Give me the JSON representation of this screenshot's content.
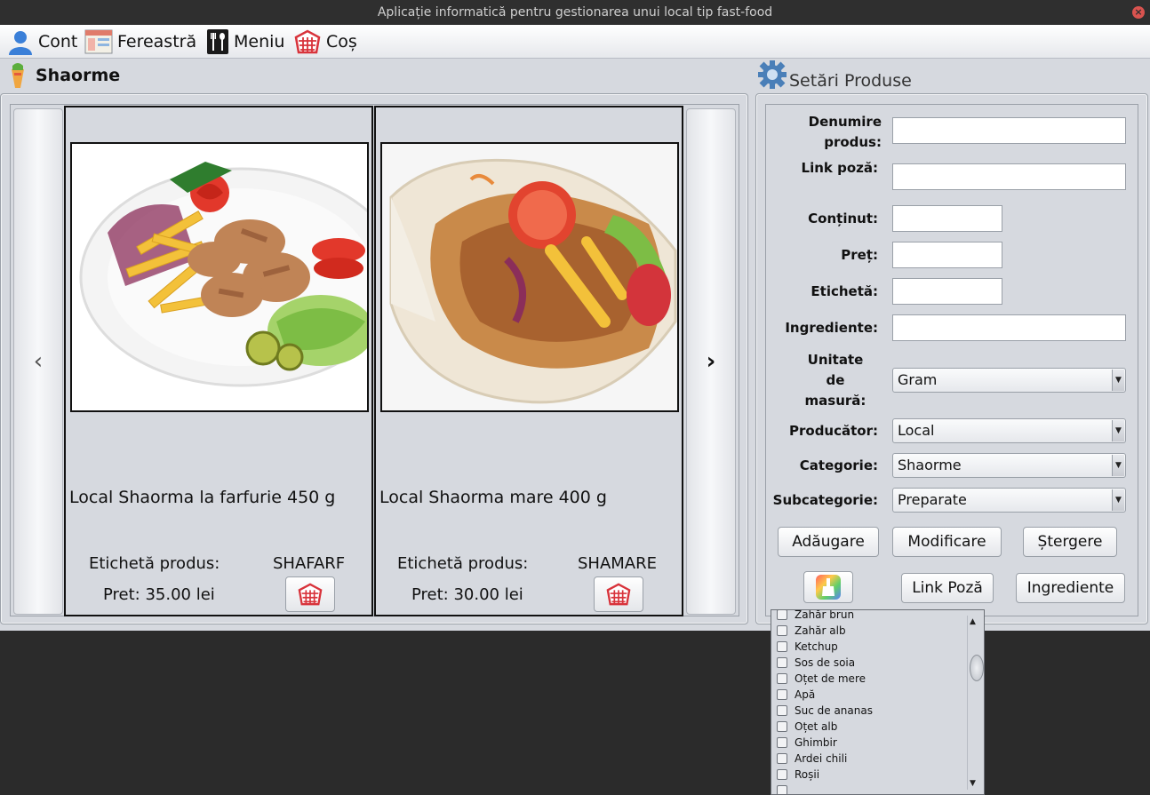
{
  "window": {
    "title": "Aplicație informatică pentru gestionarea unui local tip fast-food",
    "close_glyph": "×"
  },
  "menubar": {
    "items": [
      {
        "label": "Cont",
        "icon": "user-icon"
      },
      {
        "label": "Fereastră",
        "icon": "window-icon"
      },
      {
        "label": "Meniu",
        "icon": "cutlery-icon"
      },
      {
        "label": "Coș",
        "icon": "cart-icon"
      }
    ]
  },
  "products_panel": {
    "title": "Shaorme",
    "prev_glyph": "‹",
    "next_glyph": "›",
    "cards": [
      {
        "name": "Local Shaorma la farfurie 450 g",
        "tag_label": "Etichetă produs:",
        "tag_value": "SHAFARF",
        "price": "Pret: 35.00 lei"
      },
      {
        "name": "Local Shaorma mare 400 g",
        "tag_label": "Etichetă produs:",
        "tag_value": "SHAMARE",
        "price": "Pret: 30.00 lei"
      }
    ]
  },
  "settings_panel": {
    "title": "Setări Produse",
    "labels": {
      "denumire": "Denumire produs:",
      "link": "Link poză:",
      "continut": "Conținut:",
      "pret": "Preț:",
      "eticheta": "Etichetă:",
      "ingrediente": "Ingrediente:",
      "unitate": "Unitate de masură:",
      "producator": "Producător:",
      "categorie": "Categorie:",
      "subcategorie": "Subcategorie:"
    },
    "values": {
      "denumire": "",
      "link": "",
      "continut": "",
      "pret": "",
      "eticheta": "",
      "ingrediente": "",
      "unitate": "Gram",
      "producator": "Local",
      "categorie": "Shaorme",
      "subcategorie": "Preparate"
    },
    "buttons": {
      "add": "Adăugare",
      "modify": "Modificare",
      "delete": "Ștergere",
      "link_photo": "Link Poză",
      "ingredients": "Ingrediente"
    }
  },
  "ingredients_popup": {
    "items": [
      "Zahăr brun",
      "Zahăr alb",
      "Ketchup",
      "Sos de soia",
      "Oțet de mere",
      "Apă",
      "Suc de ananas",
      "Oțet alb",
      "Ghimbir",
      "Ardei chili",
      "Roșii"
    ]
  },
  "colors": {
    "window_bg": "#d6d9df",
    "desktop_bg": "#2b2b2b",
    "titlebar_bg": "#2f2f2f",
    "cart_red": "#d8333b"
  }
}
